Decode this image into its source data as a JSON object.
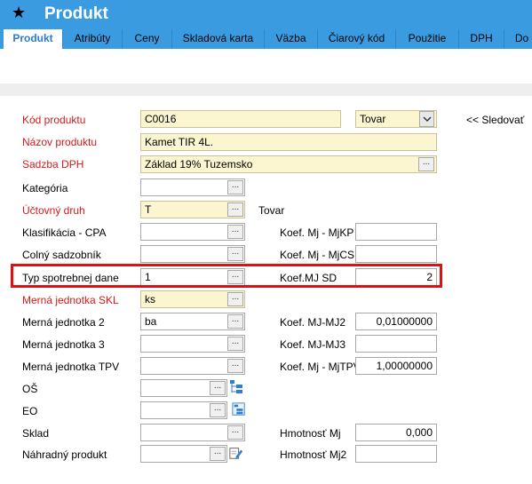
{
  "window": {
    "title": "Produkt"
  },
  "tabs": [
    "Produkt",
    "Atribúty",
    "Ceny",
    "Skladová karta",
    "Väzba",
    "Čiarový kód",
    "Použitie",
    "DPH",
    "Do"
  ],
  "form": {
    "kod_produktu": {
      "label": "Kód produktu",
      "value": "C0016"
    },
    "typ": {
      "value": "Tovar",
      "options_visible": [
        "Tovar"
      ]
    },
    "sledovat": "<< Sledovať",
    "nazov_produktu": {
      "label": "Názov produktu",
      "value": "Kamet TIR 4L."
    },
    "sadzba_dph": {
      "label": "Sadzba DPH",
      "value": "Základ 19% Tuzemsko"
    },
    "kategoria": {
      "label": "Kategória",
      "value": ""
    },
    "uctovny_druh": {
      "label": "Účtovný druh",
      "value": "T",
      "desc": "Tovar"
    },
    "klasifikacia_cpa": {
      "label": "Klasifikácia - CPA",
      "value": ""
    },
    "koef_mj_mjkp": {
      "label": "Koef. Mj - MjKP",
      "value": ""
    },
    "colny_sadzobnik": {
      "label": "Colný sadzobník",
      "value": ""
    },
    "koef_mj_mjcs": {
      "label": "Koef. Mj - MjCS",
      "value": ""
    },
    "typ_spotrebnej_dane": {
      "label": "Typ spotrebnej dane",
      "value": "1"
    },
    "koef_mj_sd": {
      "label": "Koef.MJ SD",
      "value": "2"
    },
    "merna_jednotka_skl": {
      "label": "Merná jednotka SKL",
      "value": "ks"
    },
    "merna_jednotka_2": {
      "label": "Merná jednotka 2",
      "value": "ba"
    },
    "koef_mj_mj2": {
      "label": "Koef. MJ-MJ2",
      "value": "0,01000000"
    },
    "merna_jednotka_3": {
      "label": "Merná jednotka 3",
      "value": ""
    },
    "koef_mj_mj3": {
      "label": "Koef. MJ-MJ3",
      "value": ""
    },
    "merna_jednotka_tpv": {
      "label": "Merná jednotka TPV",
      "value": ""
    },
    "koef_mj_mjtpv": {
      "label": "Koef. Mj - MjTPV",
      "value": "1,00000000"
    },
    "os": {
      "label": "OŠ",
      "value": ""
    },
    "eo": {
      "label": "EO",
      "value": ""
    },
    "sklad": {
      "label": "Sklad",
      "value": ""
    },
    "hmotnost_mj": {
      "label": "Hmotnosť Mj",
      "value": "0,000"
    },
    "nahradny_produkt": {
      "label": "Náhradný produkt",
      "value": ""
    },
    "hmotnost_mj2": {
      "label": "Hmotnosť Mj2",
      "value": ""
    }
  },
  "icons": {
    "star": "star-icon",
    "lookup": "ellipsis-button",
    "tree": "tree-icon",
    "edit": "edit-icon"
  },
  "colors": {
    "accent": "#3a9be0",
    "required": "#d11b1b",
    "highlight": "#e01010",
    "yellow_field": "#fbf6cf"
  }
}
